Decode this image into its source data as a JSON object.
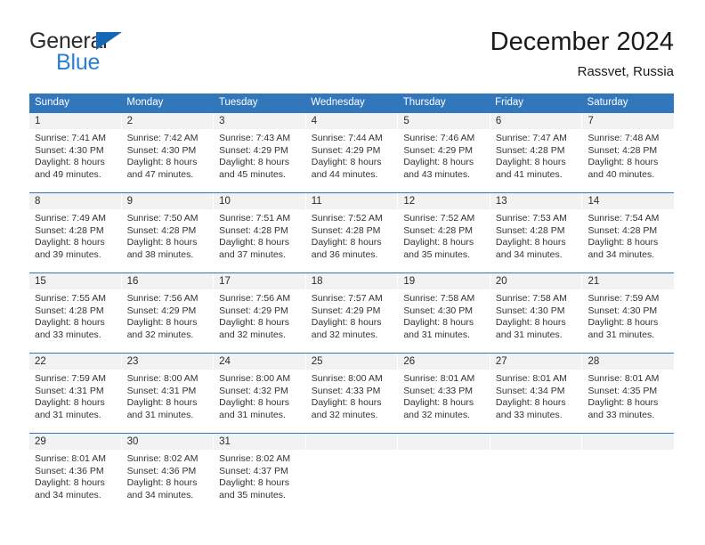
{
  "brand": {
    "name_part1": "General",
    "name_part2": "Blue",
    "triangle_icon": "blue-triangle-icon",
    "color_dark": "#2b2b2b",
    "color_blue": "#2a7fd4"
  },
  "header": {
    "title": "December 2024",
    "subtitle": "Rassvet, Russia"
  },
  "theme": {
    "header_bg": "#3277bc",
    "daynum_bg": "#f2f2f2",
    "text": "#333333"
  },
  "calendar": {
    "weekdays": [
      "Sunday",
      "Monday",
      "Tuesday",
      "Wednesday",
      "Thursday",
      "Friday",
      "Saturday"
    ],
    "weeks": [
      [
        {
          "day": "1",
          "sunrise": "Sunrise: 7:41 AM",
          "sunset": "Sunset: 4:30 PM",
          "daylight1": "Daylight: 8 hours",
          "daylight2": "and 49 minutes."
        },
        {
          "day": "2",
          "sunrise": "Sunrise: 7:42 AM",
          "sunset": "Sunset: 4:30 PM",
          "daylight1": "Daylight: 8 hours",
          "daylight2": "and 47 minutes."
        },
        {
          "day": "3",
          "sunrise": "Sunrise: 7:43 AM",
          "sunset": "Sunset: 4:29 PM",
          "daylight1": "Daylight: 8 hours",
          "daylight2": "and 45 minutes."
        },
        {
          "day": "4",
          "sunrise": "Sunrise: 7:44 AM",
          "sunset": "Sunset: 4:29 PM",
          "daylight1": "Daylight: 8 hours",
          "daylight2": "and 44 minutes."
        },
        {
          "day": "5",
          "sunrise": "Sunrise: 7:46 AM",
          "sunset": "Sunset: 4:29 PM",
          "daylight1": "Daylight: 8 hours",
          "daylight2": "and 43 minutes."
        },
        {
          "day": "6",
          "sunrise": "Sunrise: 7:47 AM",
          "sunset": "Sunset: 4:28 PM",
          "daylight1": "Daylight: 8 hours",
          "daylight2": "and 41 minutes."
        },
        {
          "day": "7",
          "sunrise": "Sunrise: 7:48 AM",
          "sunset": "Sunset: 4:28 PM",
          "daylight1": "Daylight: 8 hours",
          "daylight2": "and 40 minutes."
        }
      ],
      [
        {
          "day": "8",
          "sunrise": "Sunrise: 7:49 AM",
          "sunset": "Sunset: 4:28 PM",
          "daylight1": "Daylight: 8 hours",
          "daylight2": "and 39 minutes."
        },
        {
          "day": "9",
          "sunrise": "Sunrise: 7:50 AM",
          "sunset": "Sunset: 4:28 PM",
          "daylight1": "Daylight: 8 hours",
          "daylight2": "and 38 minutes."
        },
        {
          "day": "10",
          "sunrise": "Sunrise: 7:51 AM",
          "sunset": "Sunset: 4:28 PM",
          "daylight1": "Daylight: 8 hours",
          "daylight2": "and 37 minutes."
        },
        {
          "day": "11",
          "sunrise": "Sunrise: 7:52 AM",
          "sunset": "Sunset: 4:28 PM",
          "daylight1": "Daylight: 8 hours",
          "daylight2": "and 36 minutes."
        },
        {
          "day": "12",
          "sunrise": "Sunrise: 7:52 AM",
          "sunset": "Sunset: 4:28 PM",
          "daylight1": "Daylight: 8 hours",
          "daylight2": "and 35 minutes."
        },
        {
          "day": "13",
          "sunrise": "Sunrise: 7:53 AM",
          "sunset": "Sunset: 4:28 PM",
          "daylight1": "Daylight: 8 hours",
          "daylight2": "and 34 minutes."
        },
        {
          "day": "14",
          "sunrise": "Sunrise: 7:54 AM",
          "sunset": "Sunset: 4:28 PM",
          "daylight1": "Daylight: 8 hours",
          "daylight2": "and 34 minutes."
        }
      ],
      [
        {
          "day": "15",
          "sunrise": "Sunrise: 7:55 AM",
          "sunset": "Sunset: 4:28 PM",
          "daylight1": "Daylight: 8 hours",
          "daylight2": "and 33 minutes."
        },
        {
          "day": "16",
          "sunrise": "Sunrise: 7:56 AM",
          "sunset": "Sunset: 4:29 PM",
          "daylight1": "Daylight: 8 hours",
          "daylight2": "and 32 minutes."
        },
        {
          "day": "17",
          "sunrise": "Sunrise: 7:56 AM",
          "sunset": "Sunset: 4:29 PM",
          "daylight1": "Daylight: 8 hours",
          "daylight2": "and 32 minutes."
        },
        {
          "day": "18",
          "sunrise": "Sunrise: 7:57 AM",
          "sunset": "Sunset: 4:29 PM",
          "daylight1": "Daylight: 8 hours",
          "daylight2": "and 32 minutes."
        },
        {
          "day": "19",
          "sunrise": "Sunrise: 7:58 AM",
          "sunset": "Sunset: 4:30 PM",
          "daylight1": "Daylight: 8 hours",
          "daylight2": "and 31 minutes."
        },
        {
          "day": "20",
          "sunrise": "Sunrise: 7:58 AM",
          "sunset": "Sunset: 4:30 PM",
          "daylight1": "Daylight: 8 hours",
          "daylight2": "and 31 minutes."
        },
        {
          "day": "21",
          "sunrise": "Sunrise: 7:59 AM",
          "sunset": "Sunset: 4:30 PM",
          "daylight1": "Daylight: 8 hours",
          "daylight2": "and 31 minutes."
        }
      ],
      [
        {
          "day": "22",
          "sunrise": "Sunrise: 7:59 AM",
          "sunset": "Sunset: 4:31 PM",
          "daylight1": "Daylight: 8 hours",
          "daylight2": "and 31 minutes."
        },
        {
          "day": "23",
          "sunrise": "Sunrise: 8:00 AM",
          "sunset": "Sunset: 4:31 PM",
          "daylight1": "Daylight: 8 hours",
          "daylight2": "and 31 minutes."
        },
        {
          "day": "24",
          "sunrise": "Sunrise: 8:00 AM",
          "sunset": "Sunset: 4:32 PM",
          "daylight1": "Daylight: 8 hours",
          "daylight2": "and 31 minutes."
        },
        {
          "day": "25",
          "sunrise": "Sunrise: 8:00 AM",
          "sunset": "Sunset: 4:33 PM",
          "daylight1": "Daylight: 8 hours",
          "daylight2": "and 32 minutes."
        },
        {
          "day": "26",
          "sunrise": "Sunrise: 8:01 AM",
          "sunset": "Sunset: 4:33 PM",
          "daylight1": "Daylight: 8 hours",
          "daylight2": "and 32 minutes."
        },
        {
          "day": "27",
          "sunrise": "Sunrise: 8:01 AM",
          "sunset": "Sunset: 4:34 PM",
          "daylight1": "Daylight: 8 hours",
          "daylight2": "and 33 minutes."
        },
        {
          "day": "28",
          "sunrise": "Sunrise: 8:01 AM",
          "sunset": "Sunset: 4:35 PM",
          "daylight1": "Daylight: 8 hours",
          "daylight2": "and 33 minutes."
        }
      ],
      [
        {
          "day": "29",
          "sunrise": "Sunrise: 8:01 AM",
          "sunset": "Sunset: 4:36 PM",
          "daylight1": "Daylight: 8 hours",
          "daylight2": "and 34 minutes."
        },
        {
          "day": "30",
          "sunrise": "Sunrise: 8:02 AM",
          "sunset": "Sunset: 4:36 PM",
          "daylight1": "Daylight: 8 hours",
          "daylight2": "and 34 minutes."
        },
        {
          "day": "31",
          "sunrise": "Sunrise: 8:02 AM",
          "sunset": "Sunset: 4:37 PM",
          "daylight1": "Daylight: 8 hours",
          "daylight2": "and 35 minutes."
        },
        {
          "day": "",
          "sunrise": "",
          "sunset": "",
          "daylight1": "",
          "daylight2": ""
        },
        {
          "day": "",
          "sunrise": "",
          "sunset": "",
          "daylight1": "",
          "daylight2": ""
        },
        {
          "day": "",
          "sunrise": "",
          "sunset": "",
          "daylight1": "",
          "daylight2": ""
        },
        {
          "day": "",
          "sunrise": "",
          "sunset": "",
          "daylight1": "",
          "daylight2": ""
        }
      ]
    ]
  }
}
